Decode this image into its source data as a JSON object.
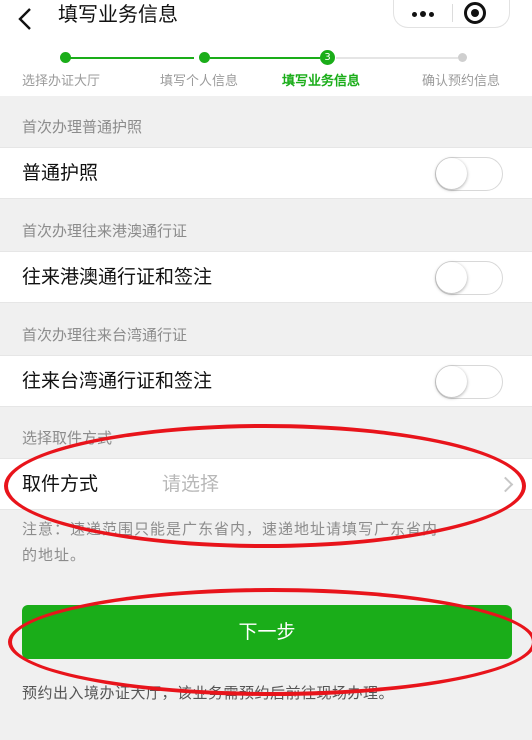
{
  "nav": {
    "back_icon": "chevron-left-icon",
    "title": "填写业务信息",
    "more_icon": "more-dots-icon",
    "close_icon": "target-close-icon"
  },
  "steps": {
    "items": [
      {
        "label": "选择办证大厅",
        "state": "done"
      },
      {
        "label": "填写个人信息",
        "state": "done"
      },
      {
        "label": "填写业务信息",
        "state": "current",
        "number": "3"
      },
      {
        "label": "确认预约信息",
        "state": "pending"
      }
    ],
    "accent_color": "#1aad19"
  },
  "sections": [
    {
      "header": "首次办理普通护照",
      "label": "普通护照",
      "enabled": false
    },
    {
      "header": "首次办理往来港澳通行证",
      "label": "往来港澳通行证和签注",
      "enabled": false
    },
    {
      "header": "首次办理往来台湾通行证",
      "label": "往来台湾通行证和签注",
      "enabled": false
    }
  ],
  "pickup": {
    "header": "选择取件方式",
    "label": "取件方式",
    "placeholder": "请选择"
  },
  "note_line1": "注意：速递范围只能是广东省内，速递地址请填写广东省内",
  "note_line2": "的地址。",
  "next_button": "下一步",
  "footer": "预约出入境办证大厅，该业务需预约后前往现场办理。",
  "annotation_color": "#e8141b"
}
